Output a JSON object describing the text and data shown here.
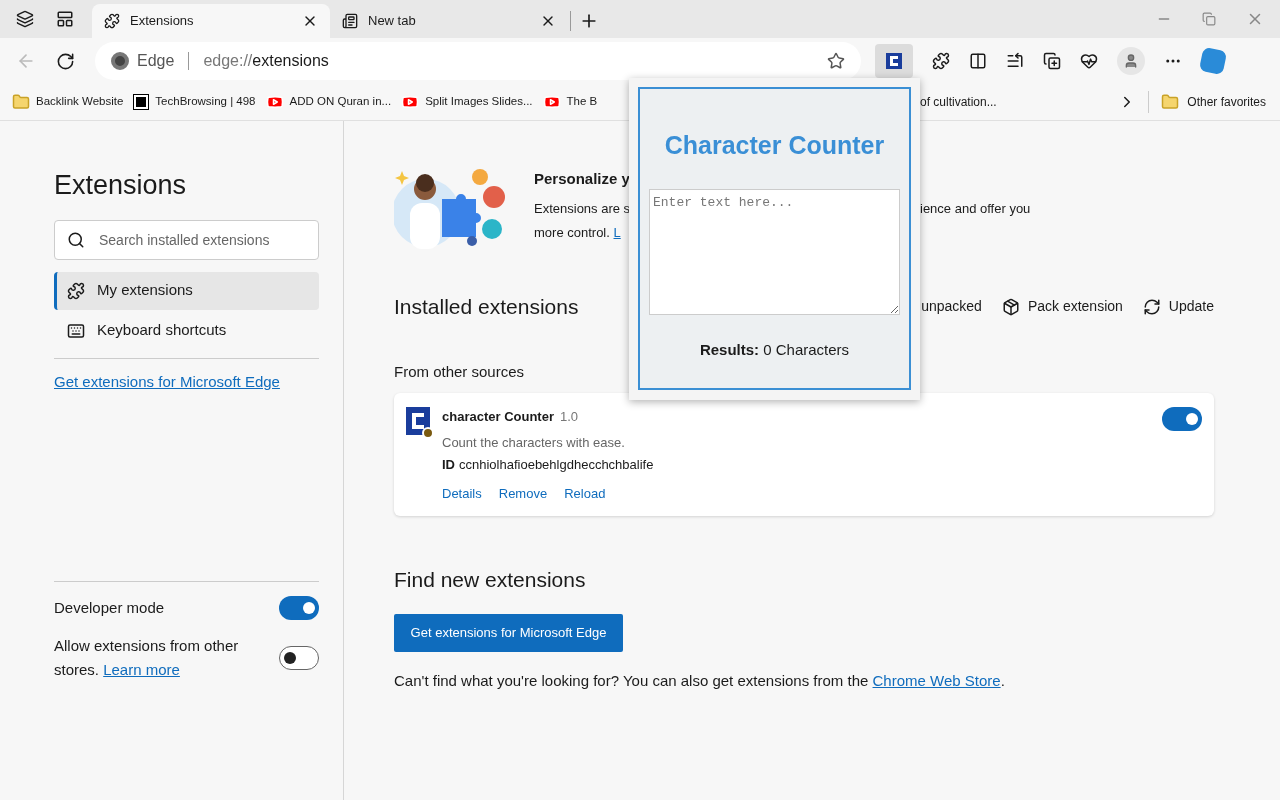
{
  "tabs": [
    {
      "label": "Extensions",
      "selected": true,
      "kind": "puzzle"
    },
    {
      "label": "New tab",
      "selected": false,
      "kind": "newtab"
    }
  ],
  "address_bar": {
    "site_label": "Edge",
    "url_prefix": "edge://",
    "url_path": "extensions"
  },
  "bookmarks": [
    {
      "label": "Backlink Website",
      "kind": "folder"
    },
    {
      "label": "TechBrowsing | 498",
      "kind": "site"
    },
    {
      "label": "ADD ON Quran in...",
      "kind": "video"
    },
    {
      "label": "Split Images Slides...",
      "kind": "video"
    },
    {
      "label": "The B",
      "kind": "video"
    },
    {
      "label": "of cultivation...",
      "kind": "text"
    }
  ],
  "other_favorites": "Other favorites",
  "sidebar": {
    "title": "Extensions",
    "search_placeholder": "Search installed extensions",
    "items": [
      {
        "label": "My extensions",
        "selected": true,
        "kind": "puzzle"
      },
      {
        "label": "Keyboard shortcuts",
        "selected": false,
        "kind": "keyboard"
      }
    ],
    "store_link": "Get extensions for Microsoft Edge",
    "developer_mode": {
      "label": "Developer mode",
      "on": true
    },
    "other_stores": {
      "label": "Allow extensions from other stores.",
      "link": "Learn more",
      "on": false
    }
  },
  "hero": {
    "title": "Personalize y",
    "line1_left": "Extensions are s",
    "line1_right": "ience and offer you",
    "line2": "more control.",
    "line2_link": "L"
  },
  "installed": {
    "title": "Installed extensions",
    "actions": [
      {
        "label": "unpacked",
        "kind": "none"
      },
      {
        "label": "Pack extension",
        "kind": "pack"
      },
      {
        "label": "Update",
        "kind": "update"
      }
    ]
  },
  "source_heading": "From other sources",
  "extension": {
    "name": "character Counter",
    "version": "1.0",
    "description": "Count the characters with ease.",
    "id_label": "ID",
    "id": "ccnhiolhafioebehlgdhecchchbalife",
    "enabled": true,
    "links": [
      "Details",
      "Remove",
      "Reload"
    ]
  },
  "find": {
    "title": "Find new extensions",
    "button": "Get extensions for Microsoft Edge",
    "text": "Can't find what you're looking for? You can also get extensions from the",
    "link": "Chrome Web Store",
    "trailing": "."
  },
  "popup": {
    "title": "Character Counter",
    "placeholder": "Enter text here...",
    "results_label": "Results:",
    "results_value": "0 Characters"
  }
}
